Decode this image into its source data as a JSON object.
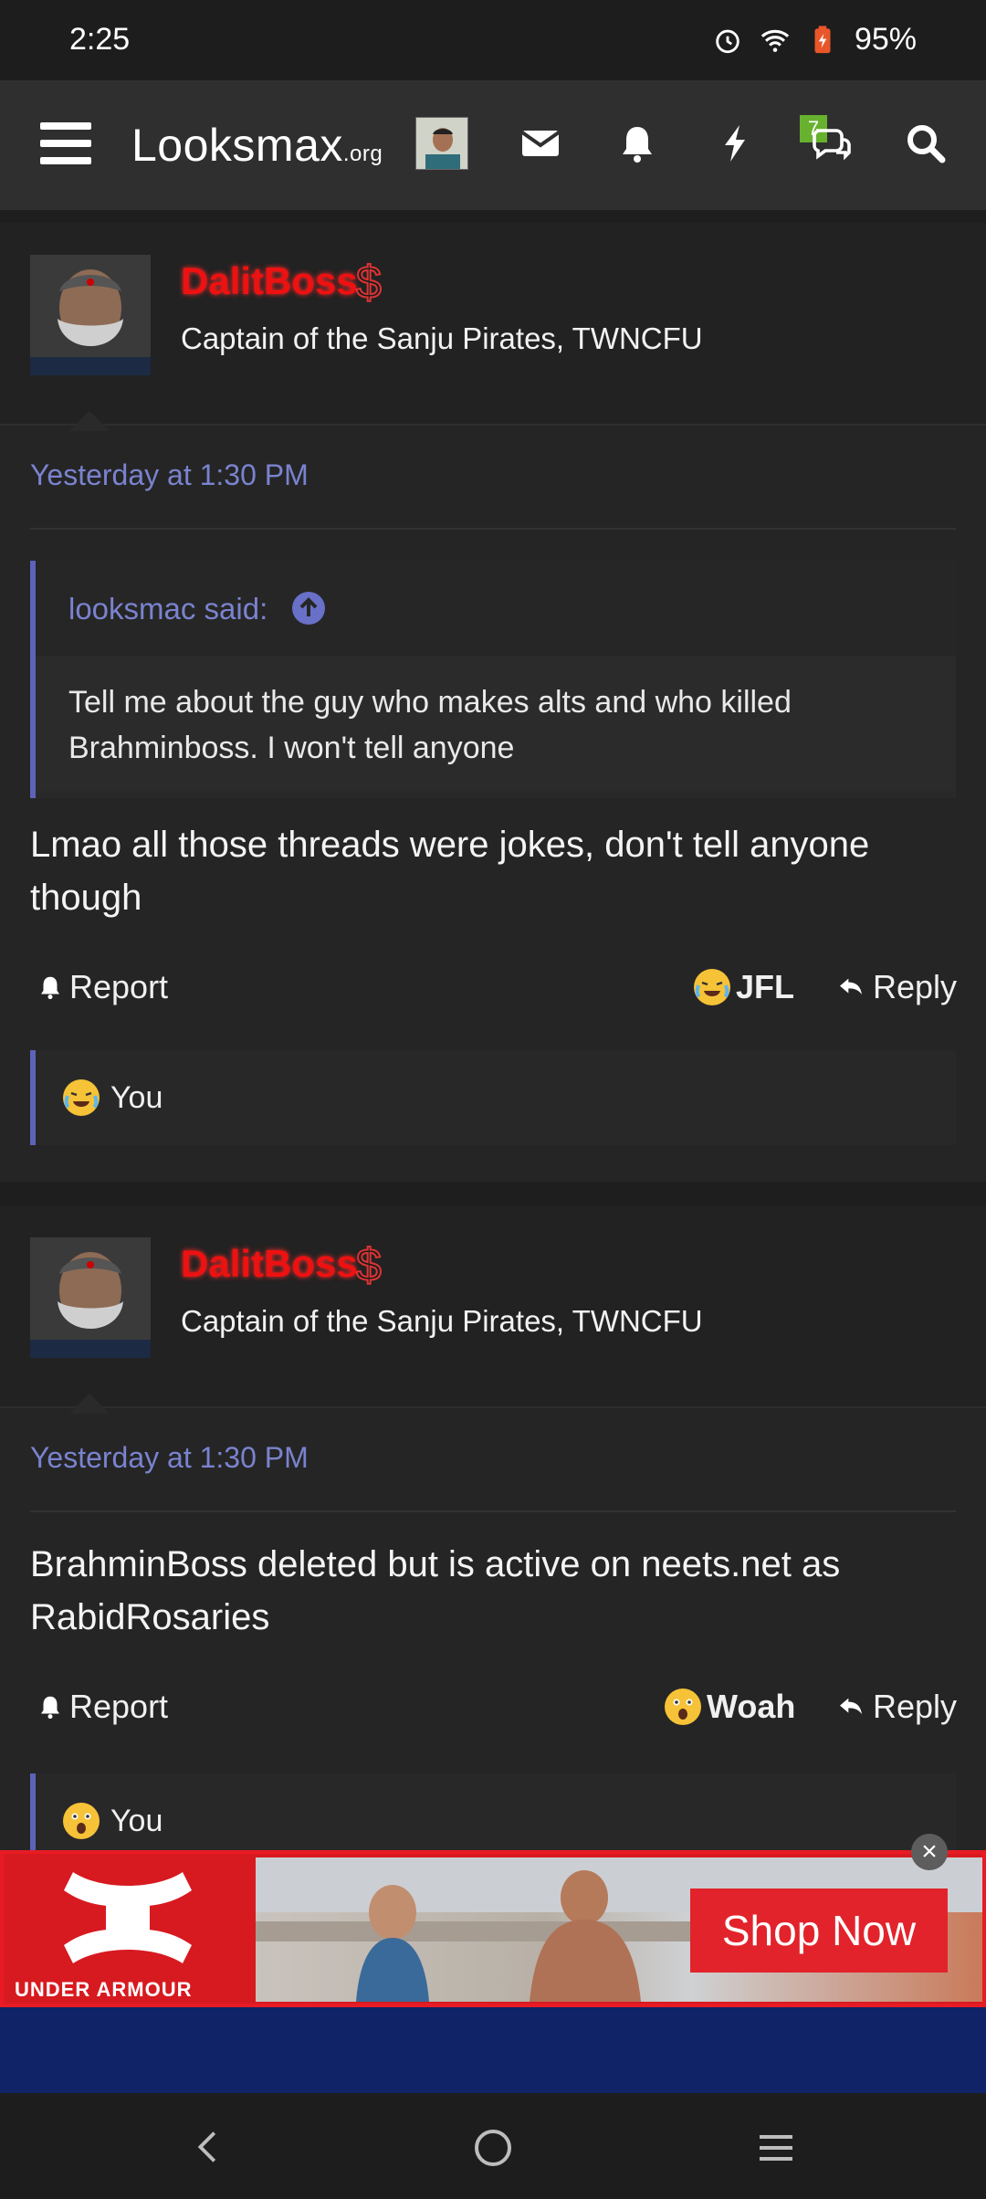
{
  "status": {
    "time": "2:25",
    "battery": "95%"
  },
  "nav": {
    "logo_main": "Looksmax",
    "logo_suffix": ".org",
    "chat_badge": "7"
  },
  "posts": [
    {
      "username": "DalitBoss",
      "user_title": "Captain of the Sanju Pirates, TWNCFU",
      "date": "Yesterday at 1:30 PM",
      "quote_author": "looksmac said:",
      "quote_text": "Tell me about the guy who makes alts and who killed Brahminboss. I won't tell anyone",
      "message": "Lmao all those threads were jokes, don't tell anyone though",
      "report_label": "Report",
      "reaction_label": "JFL",
      "reply_label": "Reply",
      "reacted_by": "You"
    },
    {
      "username": "DalitBoss",
      "user_title": "Captain of the Sanju Pirates, TWNCFU",
      "date": "Yesterday at 1:30 PM",
      "message": "BrahminBoss deleted but is active on neets.net as RabidRosaries",
      "report_label": "Report",
      "reaction_label": "Woah",
      "reply_label": "Reply",
      "reacted_by": "You"
    }
  ],
  "ad": {
    "brand": "UNDER ARMOUR",
    "cta": "Shop Now"
  },
  "colors": {
    "accent": "#7a83cf",
    "username": "#ee1111",
    "background": "#232323"
  }
}
